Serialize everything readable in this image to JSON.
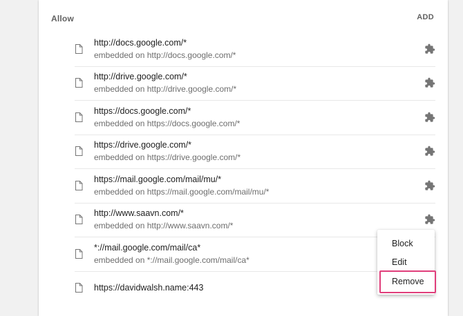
{
  "section": {
    "title": "Allow",
    "add_label": "ADD"
  },
  "rows": [
    {
      "site": "http://docs.google.com/*",
      "embedded": "embedded on http://docs.google.com/*",
      "icon": "file-icon",
      "action_icon": "puzzle-piece-icon"
    },
    {
      "site": "http://drive.google.com/*",
      "embedded": "embedded on http://drive.google.com/*",
      "icon": "file-icon",
      "action_icon": "puzzle-piece-icon"
    },
    {
      "site": "https://docs.google.com/*",
      "embedded": "embedded on https://docs.google.com/*",
      "icon": "file-icon",
      "action_icon": "puzzle-piece-icon"
    },
    {
      "site": "https://drive.google.com/*",
      "embedded": "embedded on https://drive.google.com/*",
      "icon": "file-icon",
      "action_icon": "puzzle-piece-icon"
    },
    {
      "site": "https://mail.google.com/mail/mu/*",
      "embedded": "embedded on https://mail.google.com/mail/mu/*",
      "icon": "file-icon",
      "action_icon": "puzzle-piece-icon"
    },
    {
      "site": "http://www.saavn.com/*",
      "embedded": "embedded on http://www.saavn.com/*",
      "icon": "file-icon",
      "action_icon": "puzzle-piece-icon"
    },
    {
      "site": "*://mail.google.com/mail/ca*",
      "embedded": "embedded on *://mail.google.com/mail/ca*",
      "icon": "file-icon",
      "action_icon": ""
    },
    {
      "site": "https://davidwalsh.name:443",
      "embedded": "",
      "icon": "file-icon",
      "action_icon": ""
    }
  ],
  "context_menu": {
    "items": [
      "Block",
      "Edit",
      "Remove"
    ],
    "highlighted": "Remove",
    "highlight_color": "#e03d7a"
  }
}
